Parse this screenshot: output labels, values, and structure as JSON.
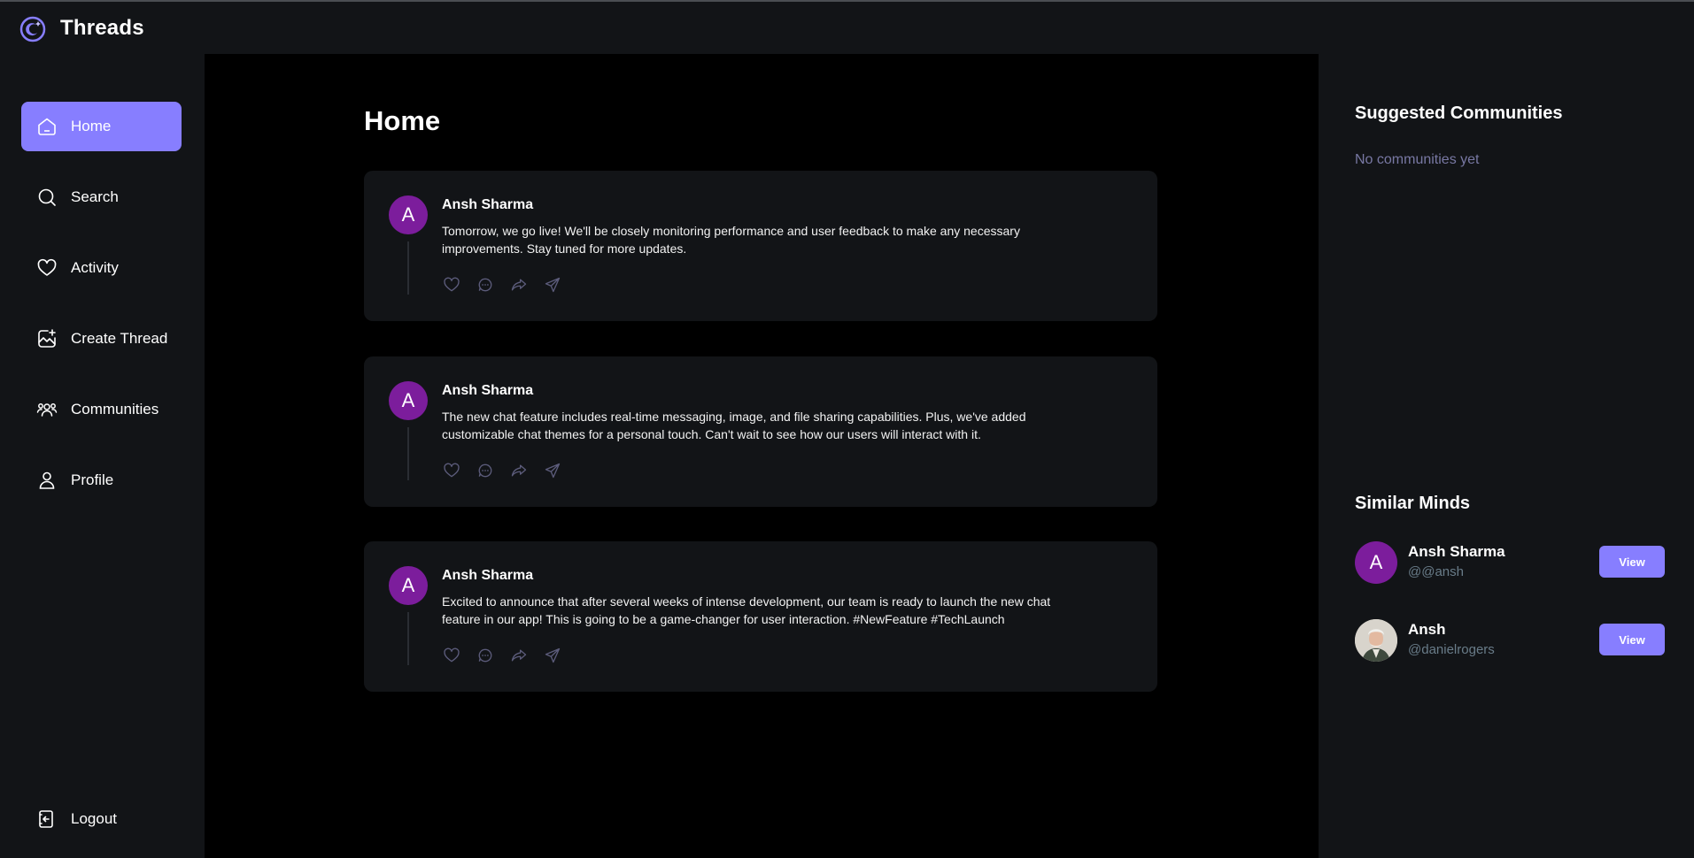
{
  "app": {
    "title": "Threads",
    "accent": "#877eff",
    "avatar_color": "#7c1d9c"
  },
  "sidebar": {
    "items": [
      {
        "label": "Home",
        "icon": "home-icon",
        "active": true
      },
      {
        "label": "Search",
        "icon": "search-icon",
        "active": false
      },
      {
        "label": "Activity",
        "icon": "heart-icon",
        "active": false
      },
      {
        "label": "Create Thread",
        "icon": "create-thread-icon",
        "active": false
      },
      {
        "label": "Communities",
        "icon": "communities-icon",
        "active": false
      },
      {
        "label": "Profile",
        "icon": "user-icon",
        "active": false
      }
    ],
    "logout_label": "Logout"
  },
  "main": {
    "title": "Home",
    "threads": [
      {
        "avatar_letter": "A",
        "author": "Ansh Sharma",
        "content": "Tomorrow, we go live! We'll be closely monitoring performance and user feedback to make any necessary improvements. Stay tuned for more updates."
      },
      {
        "avatar_letter": "A",
        "author": "Ansh Sharma",
        "content": "The new chat feature includes real-time messaging, image, and file sharing capabilities. Plus, we've added customizable chat themes for a personal touch. Can't wait to see how our users will interact with it."
      },
      {
        "avatar_letter": "A",
        "author": "Ansh Sharma",
        "content": "Excited to announce that after several weeks of intense development, our team is ready to launch the new chat feature in our app! This is going to be a game-changer for user interaction. #NewFeature #TechLaunch"
      }
    ],
    "action_icons": [
      "heart-icon",
      "reply-icon",
      "repost-icon",
      "share-icon"
    ]
  },
  "right": {
    "communities_title": "Suggested Communities",
    "communities_empty": "No communities yet",
    "minds_title": "Similar Minds",
    "minds": [
      {
        "avatar_letter": "A",
        "name": "Ansh Sharma",
        "handle": "@@ansh",
        "button": "View"
      },
      {
        "avatar": "profile-photo",
        "name": "Ansh",
        "handle": "@danielrogers",
        "button": "View"
      }
    ]
  }
}
